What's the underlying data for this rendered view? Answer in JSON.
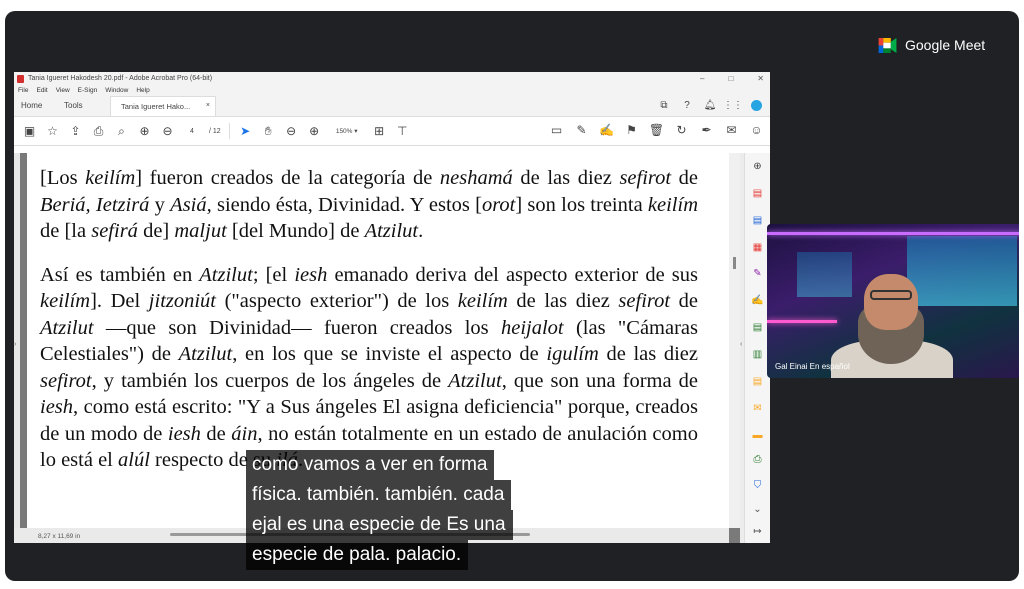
{
  "meet": {
    "logo_text": "Google Meet",
    "colors": {
      "green": "#00832d",
      "blue": "#0066da",
      "yellow": "#ffba00",
      "red": "#ea4335"
    }
  },
  "acrobat": {
    "title": "Tania Igueret Hakodesh 20.pdf - Adobe Acrobat Pro (64-bit)",
    "window_controls": [
      "–",
      "□",
      "✕"
    ],
    "menu": [
      "File",
      "Edit",
      "View",
      "E-Sign",
      "Window",
      "Help"
    ],
    "tabs": {
      "home": "Home",
      "tools": "Tools",
      "doc": "Tania Igueret Hako...",
      "close": "×"
    },
    "toolbar": {
      "page_current": "4",
      "page_total": "/ 12",
      "zoom": "150%",
      "zoom_caret": "▾"
    },
    "status": {
      "dimensions": "8,27 x 11,69 in"
    },
    "pages_arrow": "›",
    "right_arrow": "‹",
    "right_panel_icons": [
      "zoom-icon",
      "export-pdf-icon",
      "create-pdf-icon",
      "organize-pages-icon",
      "edit-pdf-icon",
      "fill-sign-icon",
      "export-icon",
      "organize-icon",
      "comment-sticker-icon",
      "request-signature-icon",
      "comment-icon",
      "print-production-icon",
      "protect-icon",
      "expand-icon",
      "collapse-panel-icon"
    ]
  },
  "document": {
    "p1": [
      {
        "t": "[Los ",
        "i": false
      },
      {
        "t": "keilím",
        "i": true
      },
      {
        "t": "] fueron creados de la categoría de ",
        "i": false
      },
      {
        "t": "neshamá",
        "i": true
      },
      {
        "t": " de las diez ",
        "i": false
      },
      {
        "t": "sefirot",
        "i": true
      },
      {
        "t": " de ",
        "i": false
      },
      {
        "t": "Beriá, Ietzirá",
        "i": true
      },
      {
        "t": " y ",
        "i": false
      },
      {
        "t": "Asiá,",
        "i": true
      },
      {
        "t": " siendo ésta, Divinidad. Y estos [",
        "i": false
      },
      {
        "t": "orot",
        "i": true
      },
      {
        "t": "] son los treinta ",
        "i": false
      },
      {
        "t": "keilím",
        "i": true
      },
      {
        "t": " de [la ",
        "i": false
      },
      {
        "t": "sefirá",
        "i": true
      },
      {
        "t": " de] ",
        "i": false
      },
      {
        "t": "maljut",
        "i": true
      },
      {
        "t": " [del Mundo] de ",
        "i": false
      },
      {
        "t": "Atzilut",
        "i": true
      },
      {
        "t": ".",
        "i": false
      }
    ],
    "p2": [
      {
        "t": "Así es también en ",
        "i": false
      },
      {
        "t": "Atzilut",
        "i": true
      },
      {
        "t": "; [el ",
        "i": false
      },
      {
        "t": "iesh",
        "i": true
      },
      {
        "t": " emanado deriva del aspecto exterior de sus ",
        "i": false
      },
      {
        "t": "keilím",
        "i": true
      },
      {
        "t": "]. Del ",
        "i": false
      },
      {
        "t": "jitzoniút",
        "i": true
      },
      {
        "t": " (\"aspecto exterior\") de los ",
        "i": false
      },
      {
        "t": "keilím",
        "i": true
      },
      {
        "t": " de las diez ",
        "i": false
      },
      {
        "t": "sefirot",
        "i": true
      },
      {
        "t": " de ",
        "i": false
      },
      {
        "t": "Atzilut",
        "i": true
      },
      {
        "t": " —que son Divinidad— fueron creados los ",
        "i": false
      },
      {
        "t": "heijalot",
        "i": true
      },
      {
        "t": " (las \"Cámaras Celestiales\") de ",
        "i": false
      },
      {
        "t": "Atzilut",
        "i": true
      },
      {
        "t": ", en los que se inviste el aspecto de ",
        "i": false
      },
      {
        "t": "igulím",
        "i": true
      },
      {
        "t": " de las diez ",
        "i": false
      },
      {
        "t": "sefirot",
        "i": true
      },
      {
        "t": ", y también los cuerpos de los ángeles de ",
        "i": false
      },
      {
        "t": "Atzilut",
        "i": true
      },
      {
        "t": ", que son una forma de ",
        "i": false
      },
      {
        "t": "iesh",
        "i": true
      },
      {
        "t": ", como está escrito: \"Y a Sus ángeles El asigna deficiencia\" porque, creados de un modo de ",
        "i": false
      },
      {
        "t": "iesh",
        "i": true
      },
      {
        "t": " de ",
        "i": false
      },
      {
        "t": "áin",
        "i": true
      },
      {
        "t": ", no están totalmente en un estado de anulación como lo está el ",
        "i": false
      },
      {
        "t": "alúl",
        "i": true
      },
      {
        "t": " respecto de su ",
        "i": false
      },
      {
        "t": "ilá",
        "i": true
      },
      {
        "t": ".",
        "i": false
      }
    ]
  },
  "participant": {
    "name": "Gal Einai En español"
  },
  "captions": {
    "lines": [
      "como vamos a ver en forma",
      "física. también. también. cada",
      "ejal es una especie de Es una",
      "especie de pala. palacio."
    ]
  }
}
